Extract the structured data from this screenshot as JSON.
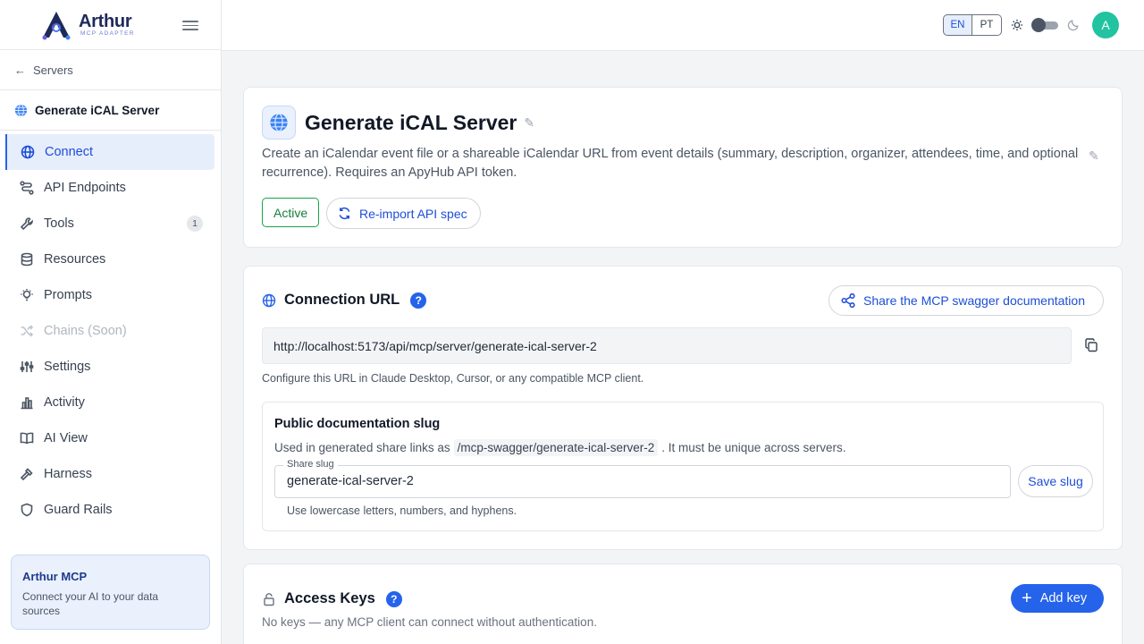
{
  "brand": {
    "name": "Arthur",
    "subtitle": "MCP ADAPTER"
  },
  "sidebar": {
    "back_label": "Servers",
    "server_name": "Generate iCAL Server",
    "items": [
      {
        "label": "Connect",
        "icon": "globe-icon",
        "active": true
      },
      {
        "label": "API Endpoints",
        "icon": "endpoints-icon"
      },
      {
        "label": "Tools",
        "icon": "wrench-icon",
        "badge": "1"
      },
      {
        "label": "Resources",
        "icon": "database-icon"
      },
      {
        "label": "Prompts",
        "icon": "lightbulb-icon"
      },
      {
        "label": "Chains (Soon)",
        "icon": "shuffle-icon",
        "disabled": true
      },
      {
        "label": "Settings",
        "icon": "sliders-icon"
      },
      {
        "label": "Activity",
        "icon": "bar-chart-icon"
      },
      {
        "label": "AI View",
        "icon": "book-icon"
      },
      {
        "label": "Harness",
        "icon": "hammer-icon"
      },
      {
        "label": "Guard Rails",
        "icon": "shield-icon"
      }
    ],
    "promo": {
      "title": "Arthur MCP",
      "text": "Connect your AI to your data sources"
    }
  },
  "topbar": {
    "lang_en": "EN",
    "lang_pt": "PT",
    "avatar_initial": "A"
  },
  "server": {
    "title": "Generate iCAL Server",
    "description": "Create an iCalendar event file or a shareable iCalendar URL from event details (summary, description, organizer, attendees, time, and optional recurrence). Requires an ApyHub API token.",
    "status": "Active",
    "reimport_label": "Re-import API spec"
  },
  "connection": {
    "title": "Connection URL",
    "help": "?",
    "share_label": "Share the MCP swagger documentation",
    "url": "http://localhost:5173/api/mcp/server/generate-ical-server-2",
    "hint": "Configure this URL in Claude Desktop, Cursor, or any compatible MCP client.",
    "slug": {
      "title": "Public documentation slug",
      "desc_before": "Used in generated share links as",
      "desc_code": "/mcp-swagger/generate-ical-server-2",
      "desc_after": ". It must be unique across servers.",
      "input_label": "Share slug",
      "input_value": "generate-ical-server-2",
      "save_label": "Save slug",
      "hint": "Use lowercase letters, numbers, and hyphens."
    }
  },
  "access_keys": {
    "title": "Access Keys",
    "help": "?",
    "add_label": "Add key",
    "hint": "No keys — any MCP client can connect without authentication."
  },
  "colors": {
    "accent": "#2563eb",
    "active_green": "#16a34a",
    "avatar": "#22c3a0"
  }
}
